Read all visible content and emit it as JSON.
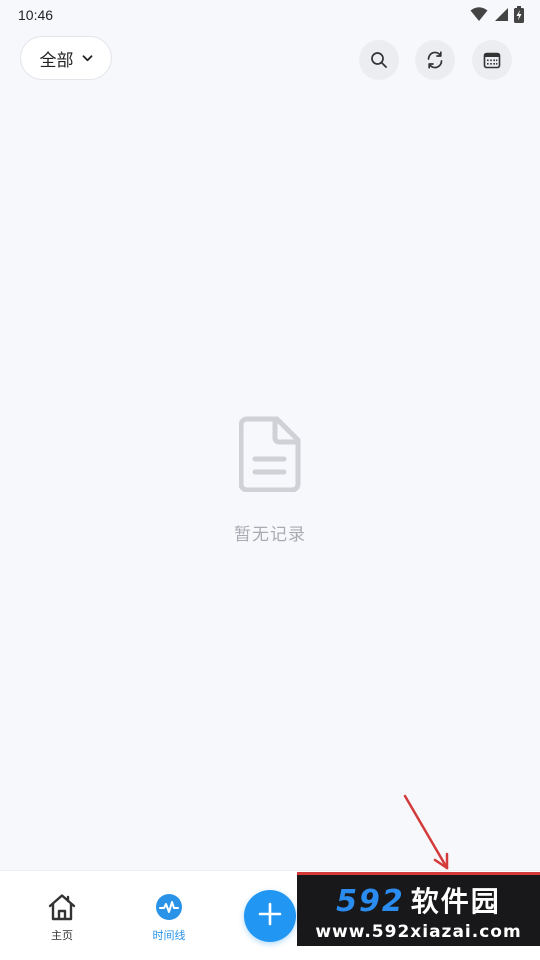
{
  "status_bar": {
    "time": "10:46",
    "icons": [
      "wifi-icon",
      "signal-icon",
      "battery-charging-icon"
    ]
  },
  "header": {
    "filter_label": "全部",
    "filter_icon": "chevron-down-icon",
    "actions": [
      {
        "name": "search",
        "icon": "search-icon"
      },
      {
        "name": "sync",
        "icon": "sync-icon"
      },
      {
        "name": "calendar",
        "icon": "calendar-icon"
      }
    ]
  },
  "empty_state": {
    "icon": "document-icon",
    "text": "暂无记录"
  },
  "bottom_nav": {
    "items": [
      {
        "label": "主页",
        "icon": "home-icon",
        "active": false
      },
      {
        "label": "时间线",
        "icon": "timeline-icon",
        "active": true
      }
    ],
    "fab_icon": "plus-icon"
  },
  "watermark": {
    "brand_number": "592",
    "brand_text": "软件园",
    "url": "www.592xiazai.com"
  },
  "colors": {
    "background": "#f7f8fc",
    "accent": "#2196f3",
    "active_label": "#2a93e8",
    "muted_text": "#a9abb2",
    "annotation_arrow": "#d33a3a"
  }
}
